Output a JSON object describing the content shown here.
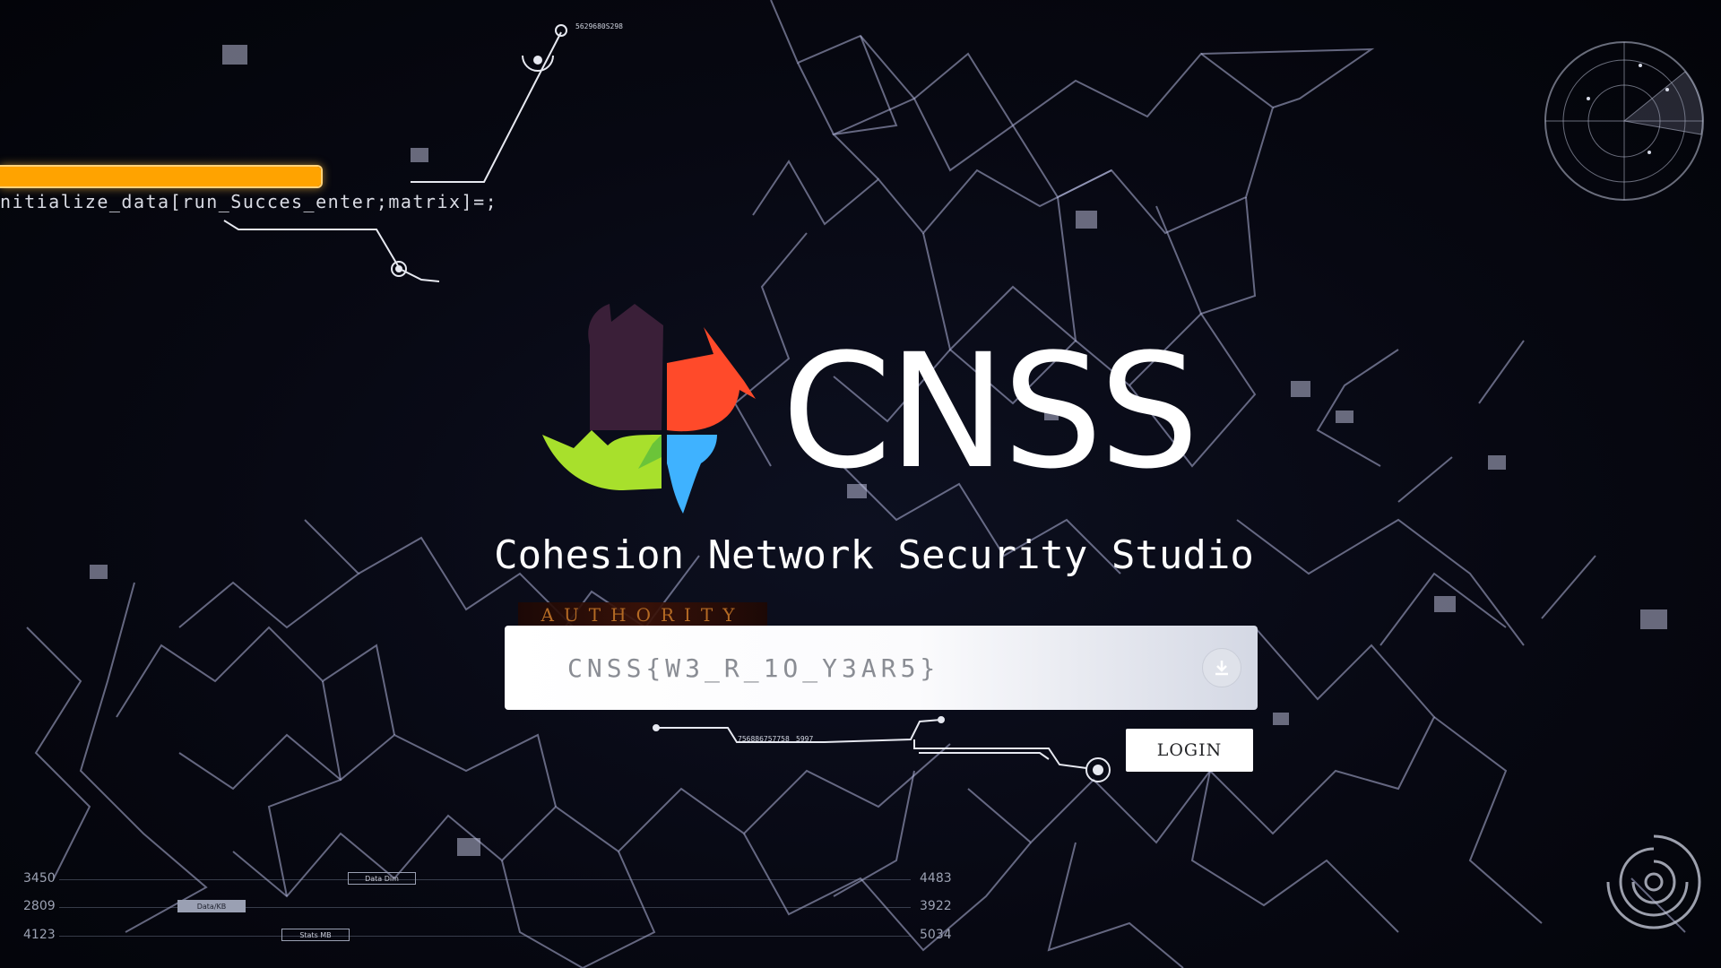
{
  "hud": {
    "top_code_line": "nitialize_data[run_Succes_enter;matrix]=;",
    "top_node_code": "5629680S298",
    "progress_percent": 100,
    "progress_color": "#ffa300"
  },
  "brand": {
    "logo_text": "CNSS",
    "subtitle": "Cohesion Network Security Studio",
    "logo_colors": [
      "#3a1f38",
      "#ff4a2a",
      "#a8e02c",
      "#3fb2ff"
    ]
  },
  "login": {
    "authority_label": "AUTHORITY",
    "key_value": "CNSS{W3_R_1O_Y3AR5}",
    "download_icon": "download-icon",
    "login_label": "LOGIN",
    "circuit_codes": [
      "756886757758",
      "5997"
    ]
  },
  "stats": {
    "rows": [
      {
        "left": "3450",
        "right": "4483",
        "chip": "Data Dim"
      },
      {
        "left": "2809",
        "right": "3922",
        "chip": "Data/KB"
      },
      {
        "left": "4123",
        "right": "5034",
        "chip": "Stats MB"
      }
    ]
  },
  "accent": {
    "network_line": "#b3b6dd",
    "background": "#05060d"
  }
}
